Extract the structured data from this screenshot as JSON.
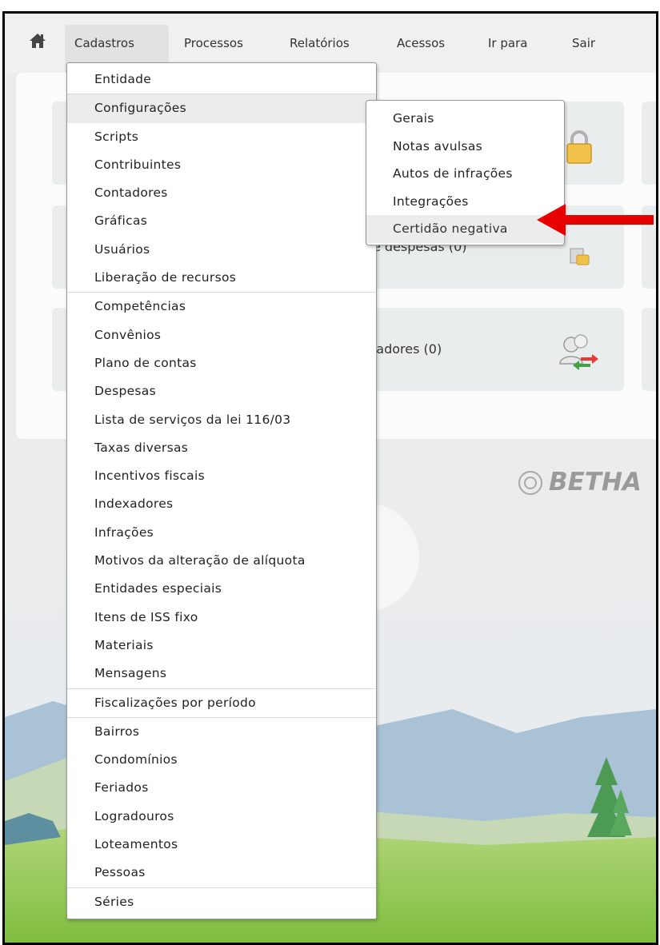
{
  "nav": {
    "items": [
      "Cadastros",
      "Processos",
      "Relatórios",
      "Acessos",
      "Ir para",
      "Sair"
    ]
  },
  "cards": {
    "card_despesas_label": "e despesas (0)",
    "card_contadores_label": "tadores (0)"
  },
  "brand": {
    "name": "BETHA"
  },
  "menu": {
    "groups": [
      [
        "Entidade"
      ],
      [
        "Configurações",
        "Scripts",
        "Contribuintes",
        "Contadores",
        "Gráficas",
        "Usuários",
        "Liberação de recursos"
      ],
      [
        "Competências",
        "Convênios",
        "Plano de contas",
        "Despesas",
        "Lista de serviços da lei 116/03",
        "Taxas diversas",
        "Incentivos fiscais",
        "Indexadores",
        "Infrações",
        "Motivos da alteração de alíquota",
        "Entidades especiais",
        "Itens de ISS fixo",
        "Materiais",
        "Mensagens"
      ],
      [
        "Fiscalizações por período"
      ],
      [
        "Bairros",
        "Condomínios",
        "Feriados",
        "Logradouros",
        "Loteamentos",
        "Pessoas"
      ],
      [
        "Séries"
      ]
    ],
    "highlighted": "Configurações"
  },
  "submenu": {
    "items": [
      "Gerais",
      "Notas avulsas",
      "Autos de infrações",
      "Integrações",
      "Certidão negativa"
    ],
    "highlighted": "Certidão negativa"
  },
  "colors": {
    "arrow": "#e60000",
    "menu_highlight": "#ececec"
  },
  "icons": [
    "home-icon",
    "padlock-icon",
    "users-sync-icon",
    "betha-logo-icon",
    "arrow-left-icon"
  ]
}
